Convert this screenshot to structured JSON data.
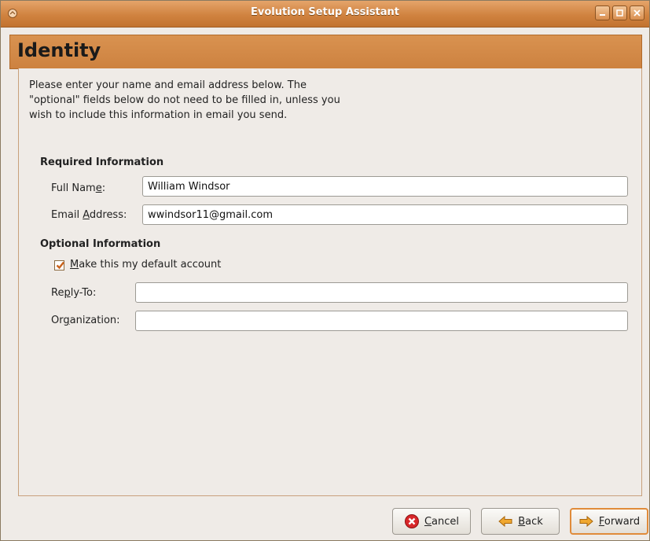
{
  "window": {
    "title": "Evolution Setup Assistant"
  },
  "page": {
    "heading": "Identity",
    "description": "Please enter your name and email address below. The \"optional\" fields below do not need to be filled in, unless you wish to include this information in email you send."
  },
  "required": {
    "section_title": "Required Information",
    "full_name_label": "Full Name:",
    "full_name_value": "William Windsor",
    "email_label": "Email Address:",
    "email_value": "wwindsor11@gmail.com"
  },
  "optional": {
    "section_title": "Optional Information",
    "default_account_label": "Make this my default account",
    "default_account_checked": true,
    "reply_to_label": "Reply-To:",
    "reply_to_value": "",
    "organization_label": "Organization:",
    "organization_value": ""
  },
  "buttons": {
    "cancel": "Cancel",
    "back": "Back",
    "forward": "Forward"
  },
  "colors": {
    "accent": "#d08340",
    "header": "#d48a48"
  }
}
